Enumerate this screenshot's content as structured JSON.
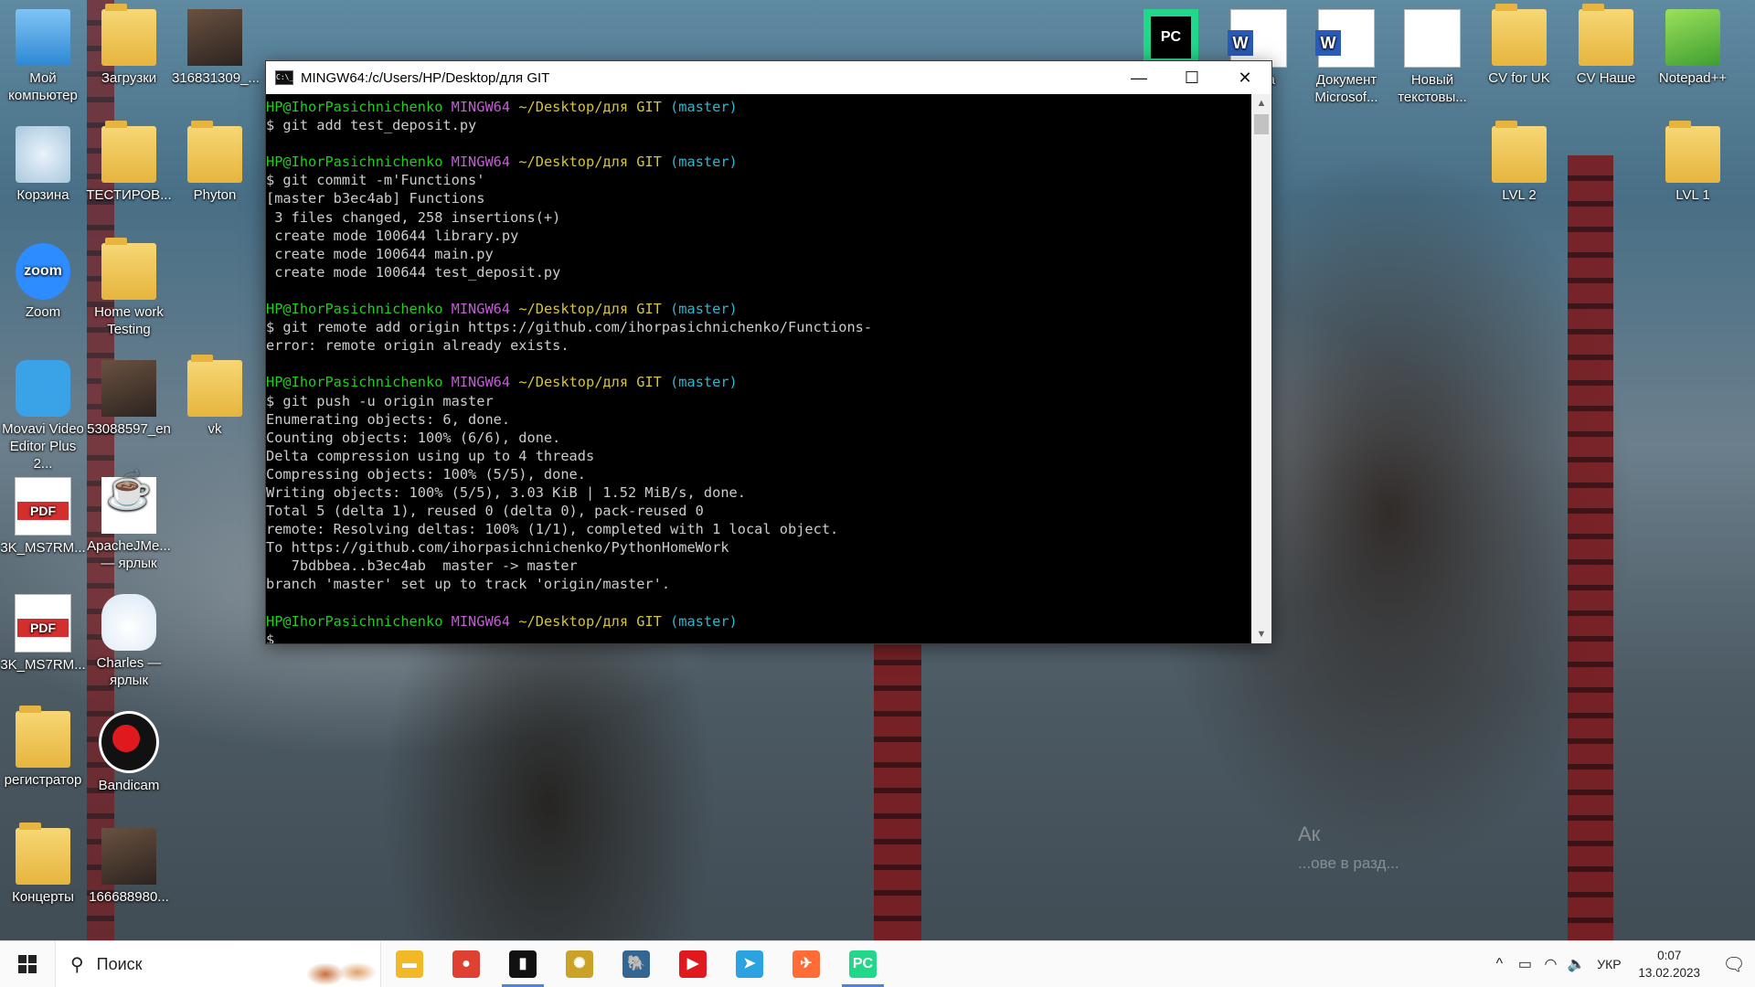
{
  "desktop": {
    "icons_left": [
      {
        "label": "Мой компьютер",
        "icon": "computer-icon"
      },
      {
        "label": "Загрузки",
        "icon": "downloads-folder-icon"
      },
      {
        "label": "316831309_...",
        "icon": "image-file-icon"
      },
      {
        "label": "Корзина",
        "icon": "recycle-bin-icon"
      },
      {
        "label": "ТЕСТИРОВ...",
        "icon": "folder-icon"
      },
      {
        "label": "Phyton",
        "icon": "folder-icon"
      },
      {
        "label": "Zoom",
        "icon": "zoom-icon"
      },
      {
        "label": "Home work Testing",
        "icon": "folder-icon"
      },
      {
        "label": "Movavi Video Editor Plus 2...",
        "icon": "movavi-icon"
      },
      {
        "label": "53088597_en",
        "icon": "image-file-icon"
      },
      {
        "label": "vk",
        "icon": "folder-icon"
      },
      {
        "label": "3K_MS7RM...",
        "icon": "pdf-icon"
      },
      {
        "label": "ApacheJMe... — ярлык",
        "icon": "java-icon"
      },
      {
        "label": "3K_MS7RM...",
        "icon": "pdf-icon"
      },
      {
        "label": "Charles — ярлык",
        "icon": "charles-icon"
      },
      {
        "label": "регистратор",
        "icon": "folder-icon"
      },
      {
        "label": "Bandicam",
        "icon": "bandicam-icon"
      },
      {
        "label": "Концерты",
        "icon": "folder-icon"
      },
      {
        "label": "166688980...",
        "icon": "photo-icon"
      }
    ],
    "icons_right": [
      {
        "label": "",
        "icon": "pycharm-icon"
      },
      {
        "label": "...нка",
        "icon": "word-icon"
      },
      {
        "label": "Документ Microsof...",
        "icon": "word-icon"
      },
      {
        "label": "Новый текстовы...",
        "icon": "text-file-icon"
      },
      {
        "label": "CV for UK",
        "icon": "folder-icon"
      },
      {
        "label": "CV Наше",
        "icon": "folder-icon"
      },
      {
        "label": "Notepad++",
        "icon": "notepadpp-icon"
      },
      {
        "label": "LVL 2",
        "icon": "folder-icon"
      },
      {
        "label": "LVL 1",
        "icon": "folder-icon"
      }
    ],
    "watermark_line1": "Ак",
    "watermark_line2": "...ове в разд..."
  },
  "terminal": {
    "title": "MINGW64:/c/Users/HP/Desktop/для GIT",
    "app_icon_text": "C:\\_",
    "controls": {
      "minimize": "—",
      "maximize": "☐",
      "close": "✕"
    },
    "prompt": {
      "user": "HP@IhorPasichnichenko",
      "shell": "MINGW64",
      "path": "~/Desktop/для GIT",
      "branch": "(master)"
    },
    "lines": [
      {
        "type": "prompt"
      },
      {
        "type": "text",
        "text": "$ git add test_deposit.py"
      },
      {
        "type": "text",
        "text": ""
      },
      {
        "type": "prompt"
      },
      {
        "type": "text",
        "text": "$ git commit -m'Functions'"
      },
      {
        "type": "text",
        "text": "[master b3ec4ab] Functions"
      },
      {
        "type": "text",
        "text": " 3 files changed, 258 insertions(+)"
      },
      {
        "type": "text",
        "text": " create mode 100644 library.py"
      },
      {
        "type": "text",
        "text": " create mode 100644 main.py"
      },
      {
        "type": "text",
        "text": " create mode 100644 test_deposit.py"
      },
      {
        "type": "text",
        "text": ""
      },
      {
        "type": "prompt"
      },
      {
        "type": "text",
        "text": "$ git remote add origin https://github.com/ihorpasichnichenko/Functions-"
      },
      {
        "type": "text",
        "text": "error: remote origin already exists."
      },
      {
        "type": "text",
        "text": ""
      },
      {
        "type": "prompt"
      },
      {
        "type": "text",
        "text": "$ git push -u origin master"
      },
      {
        "type": "text",
        "text": "Enumerating objects: 6, done."
      },
      {
        "type": "text",
        "text": "Counting objects: 100% (6/6), done."
      },
      {
        "type": "text",
        "text": "Delta compression using up to 4 threads"
      },
      {
        "type": "text",
        "text": "Compressing objects: 100% (5/5), done."
      },
      {
        "type": "text",
        "text": "Writing objects: 100% (5/5), 3.03 KiB | 1.52 MiB/s, done."
      },
      {
        "type": "text",
        "text": "Total 5 (delta 1), reused 0 (delta 0), pack-reused 0"
      },
      {
        "type": "text",
        "text": "remote: Resolving deltas: 100% (1/1), completed with 1 local object."
      },
      {
        "type": "text",
        "text": "To https://github.com/ihorpasichnichenko/PythonHomeWork"
      },
      {
        "type": "text",
        "text": "   7bdbbea..b3ec4ab  master -> master"
      },
      {
        "type": "text",
        "text": "branch 'master' set up to track 'origin/master'."
      },
      {
        "type": "text",
        "text": ""
      },
      {
        "type": "prompt"
      },
      {
        "type": "text",
        "text": "$"
      }
    ]
  },
  "taskbar": {
    "search_placeholder": "Поиск",
    "apps": [
      {
        "name": "file-explorer",
        "icon": "folder-icon",
        "glyph": "▬",
        "color": "#f2b825"
      },
      {
        "name": "chrome",
        "icon": "chrome-icon",
        "glyph": "●",
        "color": "#de4032"
      },
      {
        "name": "terminal",
        "icon": "terminal-icon",
        "glyph": "▮",
        "color": "#111111",
        "active": true
      },
      {
        "name": "chatgpt",
        "icon": "openai-icon",
        "glyph": "✺",
        "color": "#c9a227"
      },
      {
        "name": "postgres",
        "icon": "elephant-icon",
        "glyph": "🐘",
        "color": "#336791"
      },
      {
        "name": "media-player",
        "icon": "play-icon",
        "glyph": "▶",
        "color": "#e0191e"
      },
      {
        "name": "telegram",
        "icon": "telegram-icon",
        "glyph": "➤",
        "color": "#2aa3e0"
      },
      {
        "name": "postman",
        "icon": "postman-icon",
        "glyph": "✈",
        "color": "#ff6c37"
      },
      {
        "name": "pycharm",
        "icon": "pycharm-icon",
        "glyph": "PC",
        "color": "#21d789",
        "active": true
      }
    ],
    "tray": {
      "chevron": "^",
      "battery": "▭",
      "wifi": "◠",
      "volume": "🔈",
      "language": "УКР",
      "time": "0:07",
      "date": "13.02.2023",
      "notifications": "🗨"
    }
  }
}
